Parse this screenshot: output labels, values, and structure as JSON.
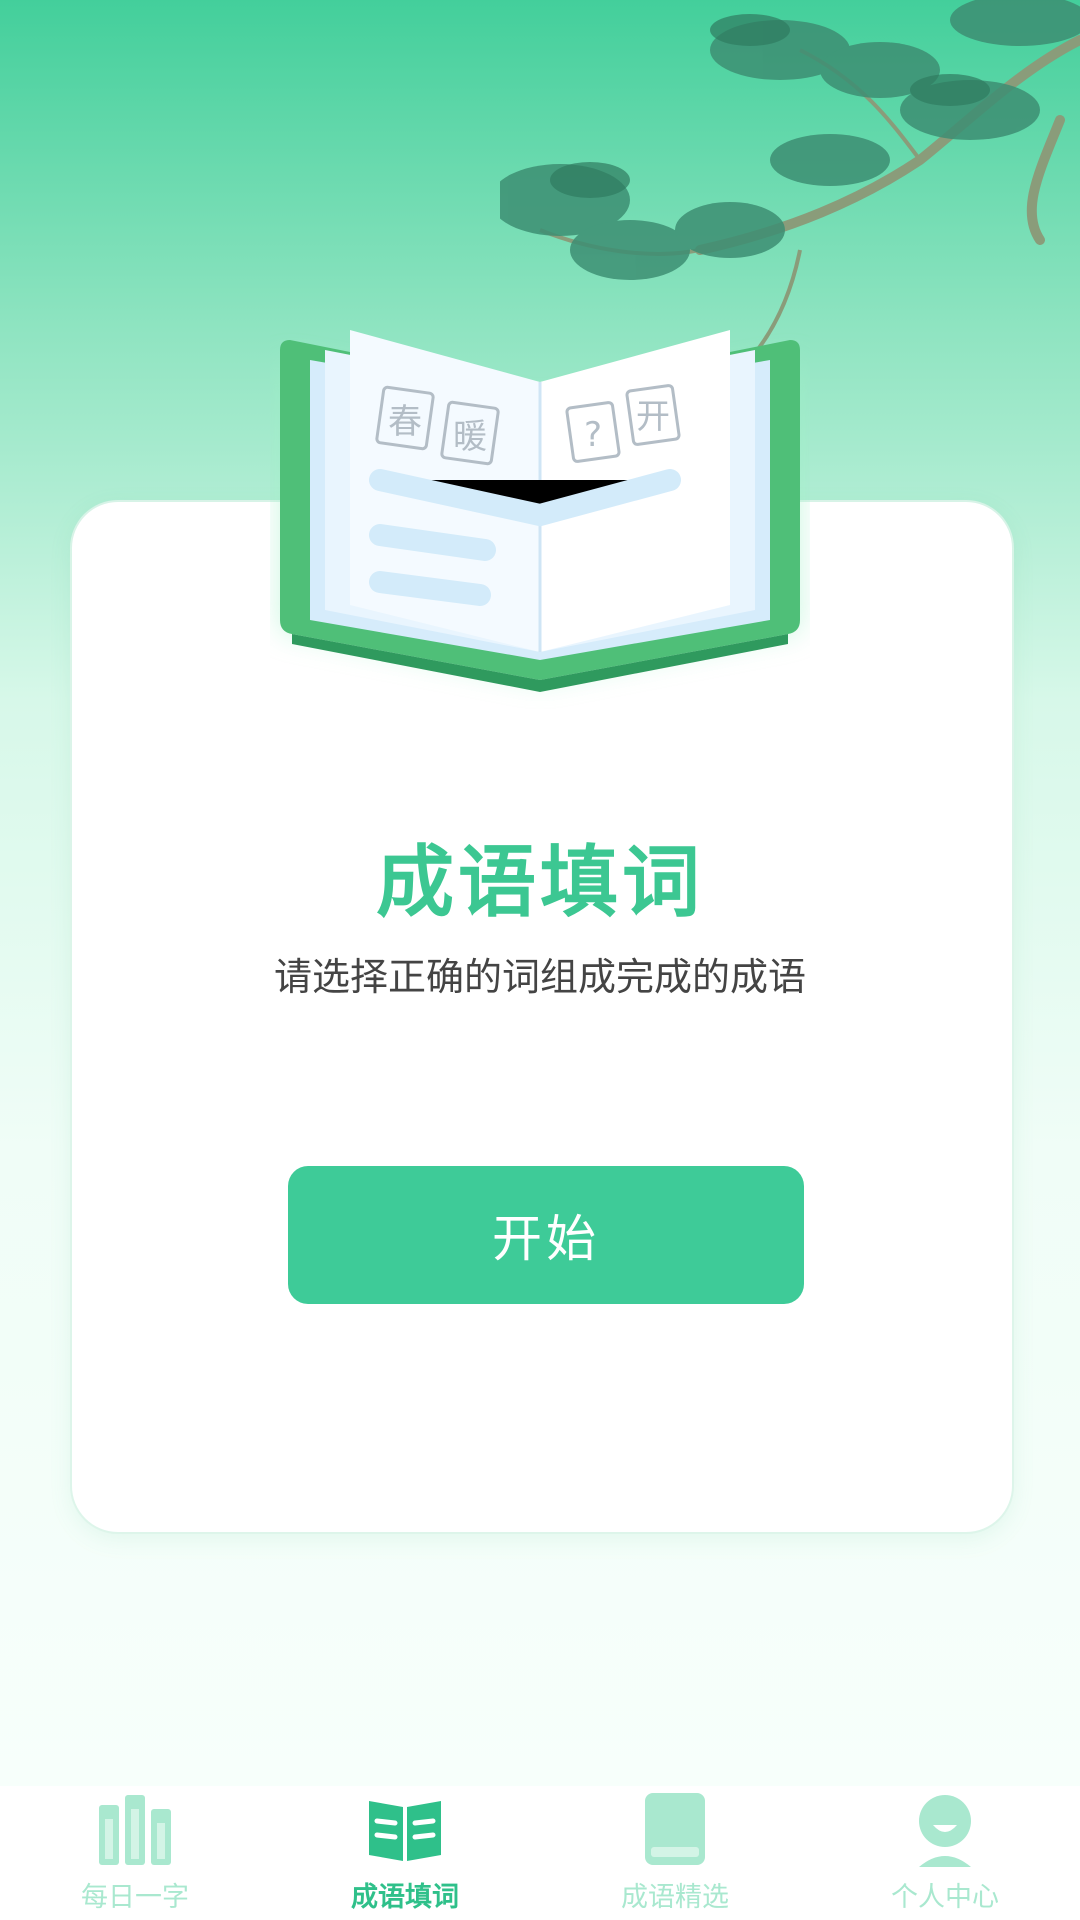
{
  "hero": {
    "book_chars": [
      "春",
      "暖",
      "?",
      "开"
    ]
  },
  "main": {
    "title": "成语填词",
    "subtitle": "请选择正确的词组成完成的成语",
    "start_label": "开始"
  },
  "tabbar": {
    "items": [
      {
        "label": "每日一字",
        "icon": "books-icon",
        "active": false
      },
      {
        "label": "成语填词",
        "icon": "open-book-icon",
        "active": true
      },
      {
        "label": "成语精选",
        "icon": "closed-book-icon",
        "active": false
      },
      {
        "label": "个人中心",
        "icon": "person-icon",
        "active": false
      }
    ]
  },
  "colors": {
    "accent": "#3ecb98",
    "title": "#3cc792",
    "tab_inactive": "#a9e8cf",
    "tab_active": "#2fc08a"
  }
}
